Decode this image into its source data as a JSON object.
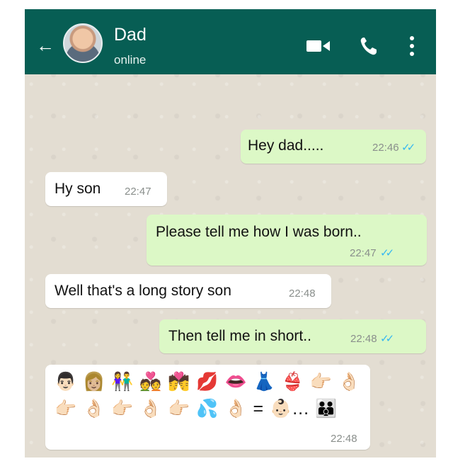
{
  "header": {
    "contact_name": "Dad",
    "status": "online"
  },
  "messages": [
    {
      "direction": "out",
      "text": "Hey dad.....",
      "time": "22:46",
      "ticks": "✓✓"
    },
    {
      "direction": "in",
      "text": "Hy son",
      "time": "22:47"
    },
    {
      "direction": "out",
      "text": "Please tell me how I was born..",
      "time": "22:47",
      "ticks": "✓✓"
    },
    {
      "direction": "in",
      "text": "Well that's a long story son",
      "time": "22:48"
    },
    {
      "direction": "out",
      "text": "Then tell me in short..",
      "time": "22:48",
      "ticks": "✓✓"
    },
    {
      "direction": "in",
      "emoji_line1": "👨🏻 👩🏼 👫 💑 💏 💋 👄 👗 👙 👉🏻 👌🏻",
      "emoji_line2": "👉🏻 👌🏻 👉🏻 👌🏻 👉🏻 💦 👌🏻 = 👶🏻... 👪",
      "time": "22:48"
    }
  ],
  "colors": {
    "header": "#075e54",
    "outgoing_bubble": "#dcf8c6",
    "incoming_bubble": "#ffffff",
    "read_ticks": "#34b7f1"
  },
  "icons": [
    "back-arrow-icon",
    "video-call-icon",
    "phone-icon",
    "more-vert-icon"
  ]
}
